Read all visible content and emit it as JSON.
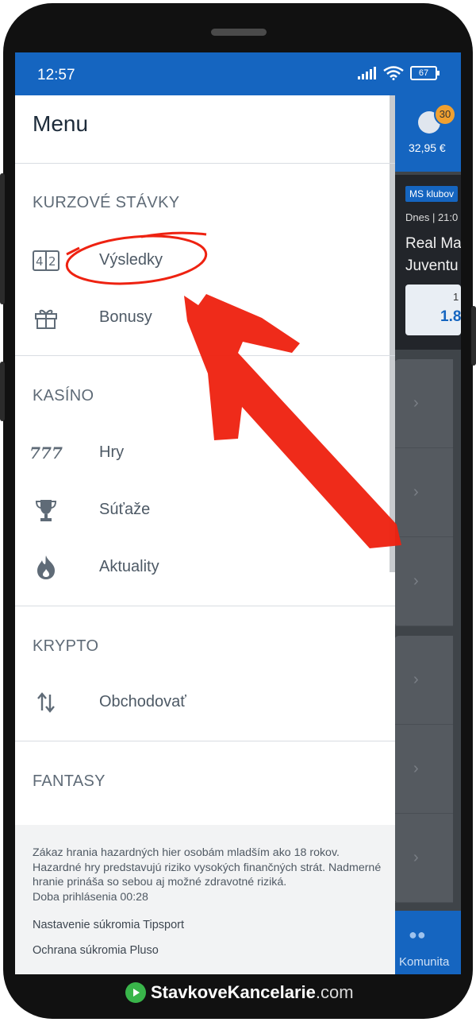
{
  "status_bar": {
    "time": "12:57",
    "battery": "67"
  },
  "background_app": {
    "badge_count": "30",
    "balance": "32,95 €",
    "league_tag": "MS klubov",
    "match_date": "Dnes | 21:0",
    "team_home": "Real Ma",
    "team_away": "Juventu",
    "odd_label": "1",
    "odd_value": "1.8",
    "nav_label": "Komunita"
  },
  "drawer": {
    "title": "Menu",
    "sections": [
      {
        "heading": "KURZOVÉ STÁVKY",
        "items": [
          {
            "label": "Výsledky",
            "icon": "scoreboard-icon"
          },
          {
            "label": "Bonusy",
            "icon": "gift-icon"
          }
        ]
      },
      {
        "heading": "KASÍNO",
        "items": [
          {
            "label": "Hry",
            "icon": "slot-777-icon"
          },
          {
            "label": "Súťaže",
            "icon": "trophy-icon"
          },
          {
            "label": "Aktuality",
            "icon": "flame-icon"
          }
        ]
      },
      {
        "heading": "KRYPTO",
        "items": [
          {
            "label": "Obchodovať",
            "icon": "up-down-arrows-icon"
          }
        ]
      },
      {
        "heading": "FANTASY",
        "items": []
      }
    ],
    "scoreboard_glyph": "42",
    "slot_glyph": "777",
    "footer": {
      "disclaimer": "Zákaz hrania hazardných hier osobám mladším ako 18 rokov. Hazardné hry predstavujú riziko vysokých finančných strát. Nadmerné hranie prináša so sebou aj možné zdravotné riziká.",
      "session": "Doba prihlásenia 00:28",
      "links": [
        "Nastavenie súkromia Tipsport",
        "Ochrana súkromia Pluso"
      ]
    }
  },
  "watermark": {
    "text_main": "StavkoveKancelarie",
    "text_tld": ".com"
  },
  "colors": {
    "brand_blue": "#1565c0",
    "annotation_red": "#ee2211"
  }
}
